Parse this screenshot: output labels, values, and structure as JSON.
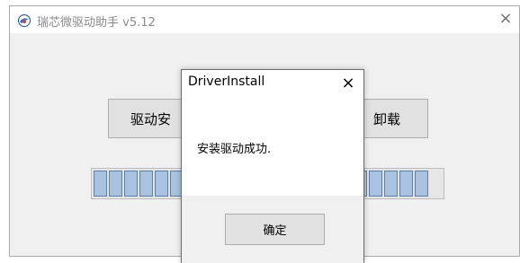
{
  "main_window": {
    "title": "瑞芯微驱动助手 v5.12",
    "icon": "app-logo-icon",
    "close_glyph": "×",
    "install_button_label": "驱动安",
    "uninstall_button_label": "卸载",
    "progress": {
      "fraction": 1.0,
      "fill_color": "#a8c2df"
    }
  },
  "dialog": {
    "title": "DriverInstall",
    "close_glyph": "×",
    "message": "安装驱动成功.",
    "ok_label": "确定"
  }
}
